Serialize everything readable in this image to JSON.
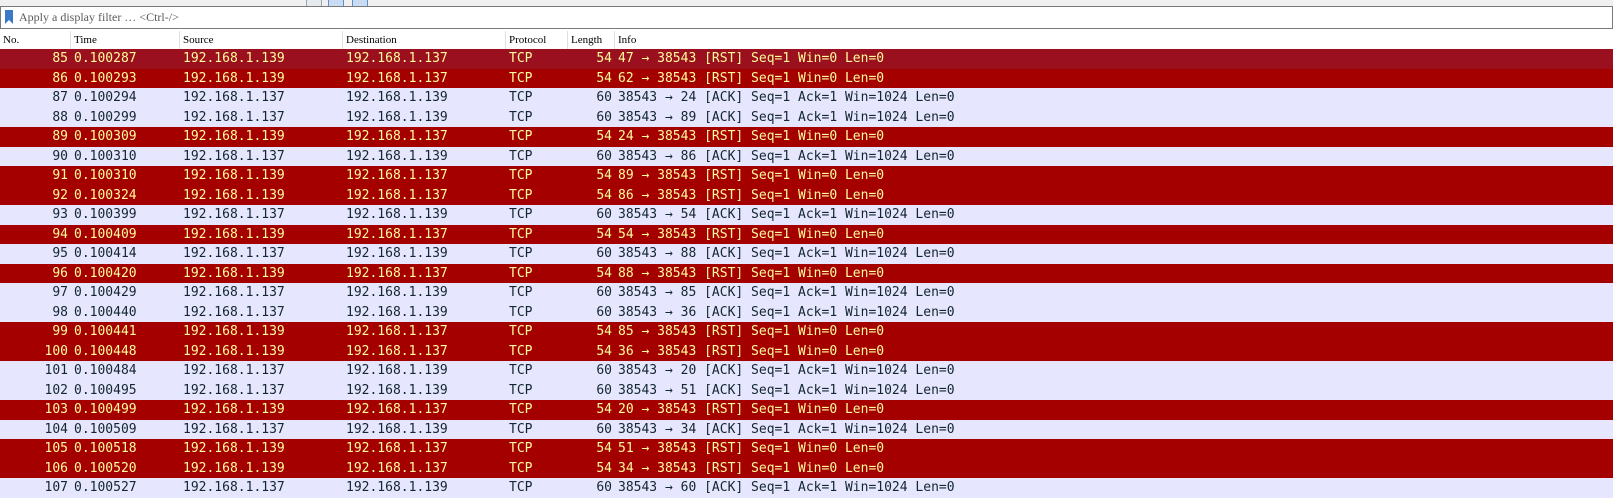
{
  "filter": {
    "placeholder": "Apply a display filter … <Ctrl-/>"
  },
  "columns": {
    "no": "No.",
    "time": "Time",
    "source": "Source",
    "destination": "Destination",
    "protocol": "Protocol",
    "length": "Length",
    "info": "Info"
  },
  "colors": {
    "rst_bg": "#a40000",
    "rst_fg": "#fffc9c",
    "ack_bg": "#e7e6ff",
    "ack_fg": "#12272e",
    "selected_bg": "#9a101e"
  },
  "packets": [
    {
      "no": "85",
      "time": "0.100287",
      "src": "192.168.1.139",
      "dst": "192.168.1.137",
      "proto": "TCP",
      "len": "54",
      "info": "47 → 38543 [RST] Seq=1 Win=0 Len=0",
      "kind": "rst",
      "selected": true
    },
    {
      "no": "86",
      "time": "0.100293",
      "src": "192.168.1.139",
      "dst": "192.168.1.137",
      "proto": "TCP",
      "len": "54",
      "info": "62 → 38543 [RST] Seq=1 Win=0 Len=0",
      "kind": "rst"
    },
    {
      "no": "87",
      "time": "0.100294",
      "src": "192.168.1.137",
      "dst": "192.168.1.139",
      "proto": "TCP",
      "len": "60",
      "info": "38543 → 24 [ACK] Seq=1 Ack=1 Win=1024 Len=0",
      "kind": "ack"
    },
    {
      "no": "88",
      "time": "0.100299",
      "src": "192.168.1.137",
      "dst": "192.168.1.139",
      "proto": "TCP",
      "len": "60",
      "info": "38543 → 89 [ACK] Seq=1 Ack=1 Win=1024 Len=0",
      "kind": "ack"
    },
    {
      "no": "89",
      "time": "0.100309",
      "src": "192.168.1.139",
      "dst": "192.168.1.137",
      "proto": "TCP",
      "len": "54",
      "info": "24 → 38543 [RST] Seq=1 Win=0 Len=0",
      "kind": "rst"
    },
    {
      "no": "90",
      "time": "0.100310",
      "src": "192.168.1.137",
      "dst": "192.168.1.139",
      "proto": "TCP",
      "len": "60",
      "info": "38543 → 86 [ACK] Seq=1 Ack=1 Win=1024 Len=0",
      "kind": "ack"
    },
    {
      "no": "91",
      "time": "0.100310",
      "src": "192.168.1.139",
      "dst": "192.168.1.137",
      "proto": "TCP",
      "len": "54",
      "info": "89 → 38543 [RST] Seq=1 Win=0 Len=0",
      "kind": "rst"
    },
    {
      "no": "92",
      "time": "0.100324",
      "src": "192.168.1.139",
      "dst": "192.168.1.137",
      "proto": "TCP",
      "len": "54",
      "info": "86 → 38543 [RST] Seq=1 Win=0 Len=0",
      "kind": "rst"
    },
    {
      "no": "93",
      "time": "0.100399",
      "src": "192.168.1.137",
      "dst": "192.168.1.139",
      "proto": "TCP",
      "len": "60",
      "info": "38543 → 54 [ACK] Seq=1 Ack=1 Win=1024 Len=0",
      "kind": "ack"
    },
    {
      "no": "94",
      "time": "0.100409",
      "src": "192.168.1.139",
      "dst": "192.168.1.137",
      "proto": "TCP",
      "len": "54",
      "info": "54 → 38543 [RST] Seq=1 Win=0 Len=0",
      "kind": "rst"
    },
    {
      "no": "95",
      "time": "0.100414",
      "src": "192.168.1.137",
      "dst": "192.168.1.139",
      "proto": "TCP",
      "len": "60",
      "info": "38543 → 88 [ACK] Seq=1 Ack=1 Win=1024 Len=0",
      "kind": "ack"
    },
    {
      "no": "96",
      "time": "0.100420",
      "src": "192.168.1.139",
      "dst": "192.168.1.137",
      "proto": "TCP",
      "len": "54",
      "info": "88 → 38543 [RST] Seq=1 Win=0 Len=0",
      "kind": "rst"
    },
    {
      "no": "97",
      "time": "0.100429",
      "src": "192.168.1.137",
      "dst": "192.168.1.139",
      "proto": "TCP",
      "len": "60",
      "info": "38543 → 85 [ACK] Seq=1 Ack=1 Win=1024 Len=0",
      "kind": "ack"
    },
    {
      "no": "98",
      "time": "0.100440",
      "src": "192.168.1.137",
      "dst": "192.168.1.139",
      "proto": "TCP",
      "len": "60",
      "info": "38543 → 36 [ACK] Seq=1 Ack=1 Win=1024 Len=0",
      "kind": "ack"
    },
    {
      "no": "99",
      "time": "0.100441",
      "src": "192.168.1.139",
      "dst": "192.168.1.137",
      "proto": "TCP",
      "len": "54",
      "info": "85 → 38543 [RST] Seq=1 Win=0 Len=0",
      "kind": "rst"
    },
    {
      "no": "100",
      "time": "0.100448",
      "src": "192.168.1.139",
      "dst": "192.168.1.137",
      "proto": "TCP",
      "len": "54",
      "info": "36 → 38543 [RST] Seq=1 Win=0 Len=0",
      "kind": "rst"
    },
    {
      "no": "101",
      "time": "0.100484",
      "src": "192.168.1.137",
      "dst": "192.168.1.139",
      "proto": "TCP",
      "len": "60",
      "info": "38543 → 20 [ACK] Seq=1 Ack=1 Win=1024 Len=0",
      "kind": "ack"
    },
    {
      "no": "102",
      "time": "0.100495",
      "src": "192.168.1.137",
      "dst": "192.168.1.139",
      "proto": "TCP",
      "len": "60",
      "info": "38543 → 51 [ACK] Seq=1 Ack=1 Win=1024 Len=0",
      "kind": "ack"
    },
    {
      "no": "103",
      "time": "0.100499",
      "src": "192.168.1.139",
      "dst": "192.168.1.137",
      "proto": "TCP",
      "len": "54",
      "info": "20 → 38543 [RST] Seq=1 Win=0 Len=0",
      "kind": "rst"
    },
    {
      "no": "104",
      "time": "0.100509",
      "src": "192.168.1.137",
      "dst": "192.168.1.139",
      "proto": "TCP",
      "len": "60",
      "info": "38543 → 34 [ACK] Seq=1 Ack=1 Win=1024 Len=0",
      "kind": "ack"
    },
    {
      "no": "105",
      "time": "0.100518",
      "src": "192.168.1.139",
      "dst": "192.168.1.137",
      "proto": "TCP",
      "len": "54",
      "info": "51 → 38543 [RST] Seq=1 Win=0 Len=0",
      "kind": "rst"
    },
    {
      "no": "106",
      "time": "0.100520",
      "src": "192.168.1.139",
      "dst": "192.168.1.137",
      "proto": "TCP",
      "len": "54",
      "info": "34 → 38543 [RST] Seq=1 Win=0 Len=0",
      "kind": "rst"
    },
    {
      "no": "107",
      "time": "0.100527",
      "src": "192.168.1.137",
      "dst": "192.168.1.139",
      "proto": "TCP",
      "len": "60",
      "info": "38543 → 60 [ACK] Seq=1 Ack=1 Win=1024 Len=0",
      "kind": "ack"
    }
  ]
}
